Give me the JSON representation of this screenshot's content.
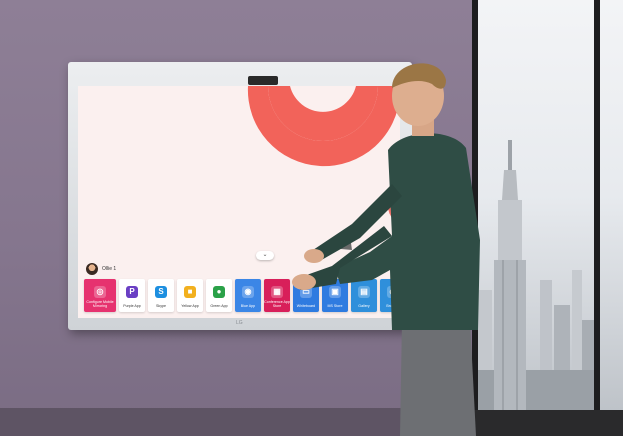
{
  "screen": {
    "expand_glyph": "⌄",
    "user": {
      "name": "Ollie 1"
    },
    "apps": [
      {
        "label": "Configure\nMobile Mirroring",
        "icon": "cast-icon",
        "color": "#e6326f",
        "dark": true
      },
      {
        "label": "Purple App",
        "icon": "P",
        "color": "#6a3fc4",
        "dark": false
      },
      {
        "label": "Skype",
        "icon": "S",
        "color": "#1d8fe0",
        "dark": false
      },
      {
        "label": "Yellow App",
        "icon": "■",
        "color": "#f2b01e",
        "dark": false
      },
      {
        "label": "Green App",
        "icon": "●",
        "color": "#2aa148",
        "dark": false
      },
      {
        "label": "Blue App",
        "icon": "◉",
        "color": "#3b86e6",
        "dark": true
      },
      {
        "label": "Conference\nApp Store",
        "icon": "▦",
        "color": "#d81f5a",
        "dark": true
      },
      {
        "label": "Whiteboard",
        "icon": "▭",
        "color": "#2f7be0",
        "dark": true
      },
      {
        "label": "MS Store",
        "icon": "▣",
        "color": "#2f7be0",
        "dark": true
      },
      {
        "label": "Gallery",
        "icon": "▤",
        "color": "#2f8fdb",
        "dark": true
      },
      {
        "label": "Browser",
        "icon": "◍",
        "color": "#2f8fdb",
        "dark": true
      }
    ]
  },
  "brand": {
    "logo_text": "LG"
  },
  "colors": {
    "accent_ring": "#f2635a",
    "wall": "#8a7b92"
  }
}
